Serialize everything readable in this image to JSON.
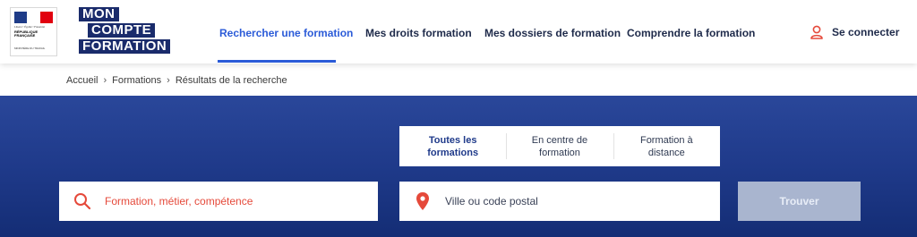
{
  "header": {
    "ministry_logo": {
      "line1": "Liberté • Égalité • Fraternité",
      "line2": "RÉPUBLIQUE FRANÇAISE",
      "line3": "MINISTÈRE DU TRAVAIL",
      "flag_colors": [
        "#1f3c88",
        "#ffffff",
        "#e1000f"
      ]
    },
    "brand": {
      "line1": "MON",
      "line2": "COMPTE",
      "line3": "FORMATION",
      "color": "#1a2b6b"
    },
    "nav": [
      {
        "label": "Rechercher une formation",
        "active": true
      },
      {
        "label": "Mes droits formation",
        "active": false
      },
      {
        "label": "Mes dossiers de formation",
        "active": false
      },
      {
        "label": "Comprendre la formation",
        "active": false
      }
    ],
    "login": {
      "label": "Se connecter",
      "icon": "user-icon"
    },
    "accent_color": "#2b5bd8"
  },
  "breadcrumb": [
    "Accueil",
    "Formations",
    "Résultats de la recherche"
  ],
  "search": {
    "modes": [
      {
        "label_line1": "Toutes les",
        "label_line2": "formations",
        "active": true
      },
      {
        "label_line1": "En centre de",
        "label_line2": "formation",
        "active": false
      },
      {
        "label_line1": "Formation à",
        "label_line2": "distance",
        "active": false
      }
    ],
    "query": {
      "placeholder": "Formation, métier, compétence",
      "icon": "search-icon",
      "color": "#e5493a"
    },
    "location": {
      "placeholder": "Ville ou code postal",
      "icon": "location-pin-icon"
    },
    "submit_label": "Trouver"
  }
}
